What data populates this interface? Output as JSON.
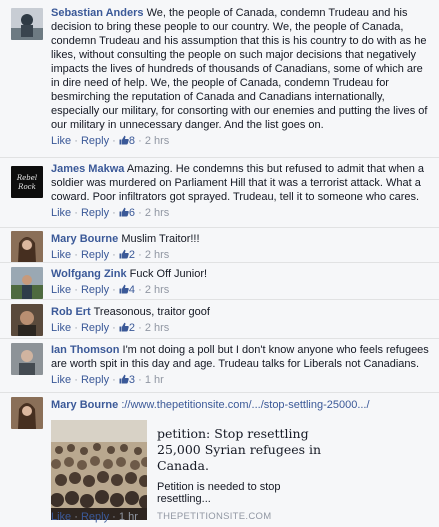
{
  "ui": {
    "like": "Like",
    "reply": "Reply",
    "dot": "·"
  },
  "comments": [
    {
      "author": "Sebastian Anders",
      "text": "We, the people of Canada, condemn Trudeau and his decision to bring these people to our country. We, the people of Canada, condemn Trudeau and his assumption that this is his country to do with as he likes, without consulting the people on such major decisions that negatively impacts the lives of hundreds of thousands of Canadians, some of which are in dire need of help. We, the people of Canada, condemn Trudeau for besmirching the reputation of Canada and Canadians internationally, especially our military, for consorting with our enemies and putting the lives of our military in unnecessary danger. And the list goes on.",
      "likes": "8",
      "time": "2 hrs"
    },
    {
      "author": "James Makwa",
      "text": "Amazing. He condemns this but refused to admit that when a soldier was murdered on Parliament Hill that it was a terrorist attack. What a coward. Poor infiltrators got sprayed. Trudeau, tell it to someone who cares.",
      "likes": "6",
      "time": "2 hrs"
    },
    {
      "author": "Mary Bourne",
      "text": "Muslim Traitor!!!",
      "likes": "2",
      "time": "2 hrs"
    },
    {
      "author": "Wolfgang Zink",
      "text": "Fuck Off Junior!",
      "likes": "4",
      "time": "2 hrs"
    },
    {
      "author": "Rob Ert",
      "text": "Treasonous, traitor goof",
      "likes": "2",
      "time": "2 hrs"
    },
    {
      "author": "Ian Thomson",
      "text": "I'm not doing a poll but I don't know anyone who feels refugees are worth spit in this day and age. Trudeau talks for Liberals not Canadians.",
      "likes": "3",
      "time": "1 hr"
    },
    {
      "author": "Mary Bourne",
      "text": "://www.thepetitionsite.com/.../stop-settling-25000.../",
      "time": "1 hr",
      "attachment": {
        "title": "petition: Stop resettling 25,000 Syrian refugees in Canada.",
        "description": "Petition is needed to stop resettling...",
        "source": "THEPETITIONSITE.COM"
      }
    }
  ]
}
